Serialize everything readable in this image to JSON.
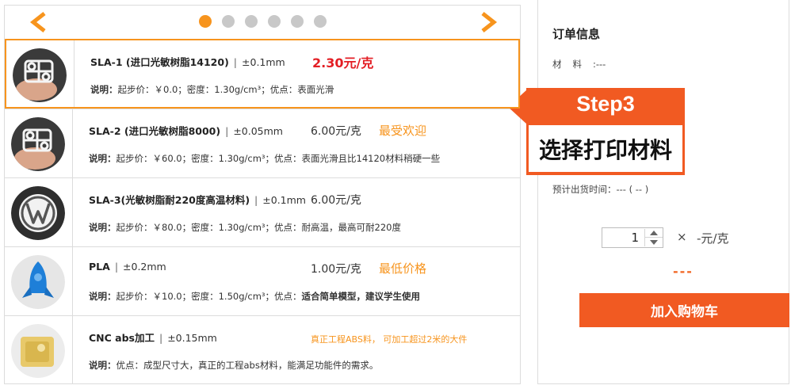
{
  "carousel": {
    "prev_icon": "chevron-left-icon",
    "next_icon": "chevron-right-icon",
    "dot_count": 6,
    "active_dot": 1,
    "accent": "#f7941d"
  },
  "materials": [
    {
      "name": "SLA-1 (进口光敏树脂14120)",
      "tolerance": "±0.1mm",
      "price": "2.30元/克",
      "tag": "",
      "desc_label": "说明：",
      "desc": "起步价：￥0.0；密度：1.30g/cm³；优点：表面光滑",
      "desc_bold": "",
      "selected": true
    },
    {
      "name": "SLA-2 (进口光敏树脂8000)",
      "tolerance": "±0.05mm",
      "price": "6.00元/克",
      "tag": "最受欢迎",
      "desc_label": "说明：",
      "desc": "起步价：￥60.0；密度：1.30g/cm³；优点：表面光滑且比14120材料稍硬一些",
      "desc_bold": ""
    },
    {
      "name": "SLA-3(光敏树脂耐220度高温材料)",
      "tolerance": "±0.1mm",
      "price": "6.00元/克",
      "tag": "",
      "desc_label": "说明：",
      "desc": "起步价：￥80.0；密度：1.30g/cm³；优点：耐高温，最高可耐220度",
      "desc_bold": ""
    },
    {
      "name": "PLA",
      "tolerance": "±0.2mm",
      "price": "1.00元/克",
      "tag": "最低价格",
      "desc_label": "说明：",
      "desc": "起步价：￥10.0；密度：1.50g/cm³；优点：",
      "desc_bold": "适合简单模型，建议学生使用"
    },
    {
      "name": "CNC abs加工",
      "tolerance": "±0.15mm",
      "price": "",
      "tag": "真正工程ABS料， 可加工超过2米的大件",
      "desc_label": "说明：",
      "desc": "优点：成型尺寸大，真正的工程abs材料，能满足功能件的需求。",
      "desc_bold": ""
    }
  ],
  "order": {
    "title": "订单信息",
    "material_label": "材料",
    "material_value": "---",
    "ship_label": "预计出货时间：",
    "ship_value": "--- ( -- )",
    "quantity": "1",
    "times": "×",
    "unit_price": "-元/克",
    "total": "---",
    "add_to_cart": "加入购物车"
  },
  "callout": {
    "step": "Step3",
    "text": "选择打印材料",
    "color": "#f15a22"
  },
  "colors": {
    "orange": "#f7941d",
    "red_price": "#e31e24",
    "cart_button": "#f15a22"
  }
}
